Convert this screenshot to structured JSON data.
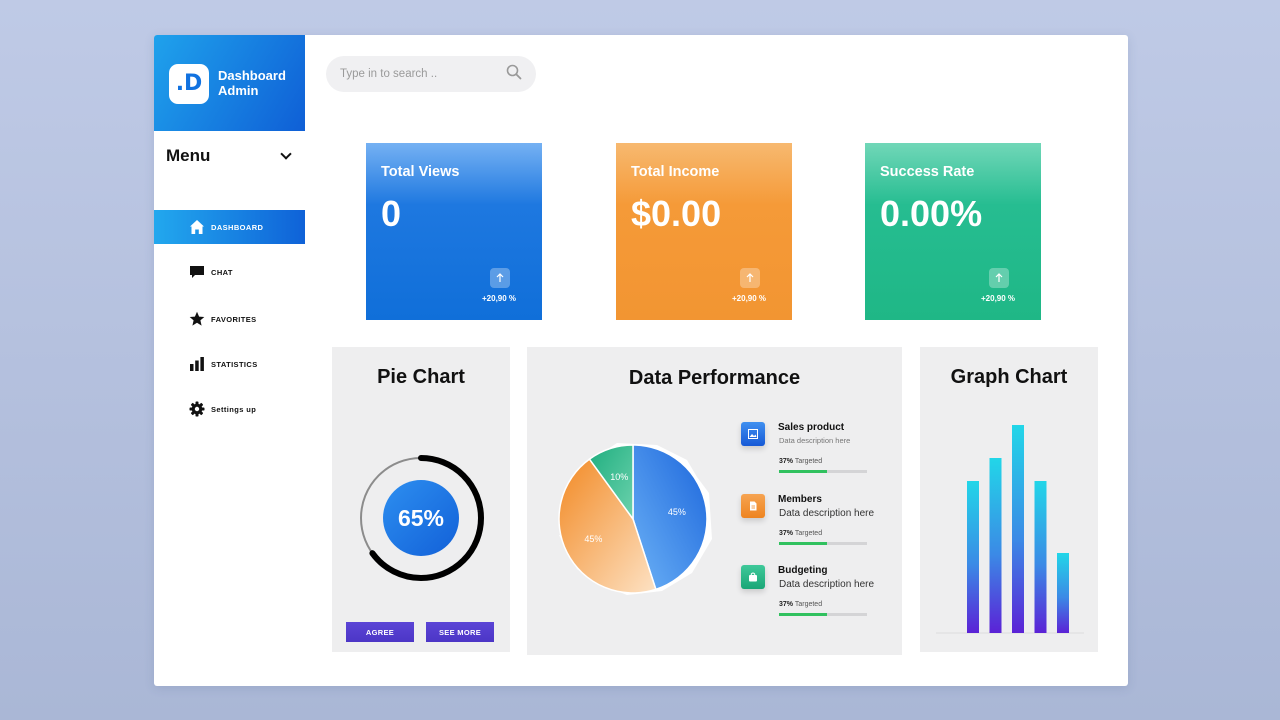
{
  "brand": {
    "logo": ".D",
    "name": "Dashboard Admin"
  },
  "menu": {
    "title": "Menu"
  },
  "nav": [
    {
      "label": "DASHBOARD",
      "icon": "home-icon",
      "active": true
    },
    {
      "label": "CHAT",
      "icon": "chat-icon",
      "active": false
    },
    {
      "label": "FAVORITES",
      "icon": "star-icon",
      "active": false
    },
    {
      "label": "STATISTICS",
      "icon": "bar-chart-icon",
      "active": false
    },
    {
      "label": "Settings up",
      "icon": "gear-icon",
      "active": false
    }
  ],
  "search": {
    "placeholder": "Type in to search .."
  },
  "cards": [
    {
      "title": "Total Views",
      "value": "0",
      "change": "+20,90 %",
      "color": "#1173de"
    },
    {
      "title": "Total Income",
      "value": "$0.00",
      "change": "+20,90 %",
      "color": "#f49a36"
    },
    {
      "title": "Success Rate",
      "value": "0.00%",
      "change": "+20,90 %",
      "color": "#21b988"
    }
  ],
  "pie_panel": {
    "title": "Pie Chart",
    "progress_label": "65%",
    "progress": 0.65,
    "agree_label": "AGREE",
    "see_more_label": "SEE MORE"
  },
  "performance": {
    "title": "Data Performance",
    "items": [
      {
        "title": "Sales product",
        "desc": "Data description here",
        "pct": "37%",
        "meta": "Targeted",
        "progress": 0.55,
        "color": "#1f6fe0"
      },
      {
        "title": "Members",
        "desc": "Data description here",
        "pct": "37%",
        "meta": "Targeted",
        "progress": 0.55,
        "color": "#f39536"
      },
      {
        "title": "Budgeting",
        "desc": "Data description here",
        "pct": "37%",
        "meta": "Targeted",
        "progress": 0.55,
        "color": "#22b585"
      }
    ]
  },
  "graph_panel": {
    "title": "Graph Chart"
  },
  "chart_data": [
    {
      "type": "pie",
      "slices": [
        {
          "label": "45%",
          "value": 45,
          "color": "#2f7fe6"
        },
        {
          "label": "45%",
          "value": 45,
          "color": "#f39131"
        },
        {
          "label": "10%",
          "value": 10,
          "color": "#27b283"
        }
      ]
    },
    {
      "type": "bar",
      "values": [
        152,
        175,
        208,
        152,
        80
      ],
      "ylim": [
        0,
        210
      ]
    }
  ]
}
